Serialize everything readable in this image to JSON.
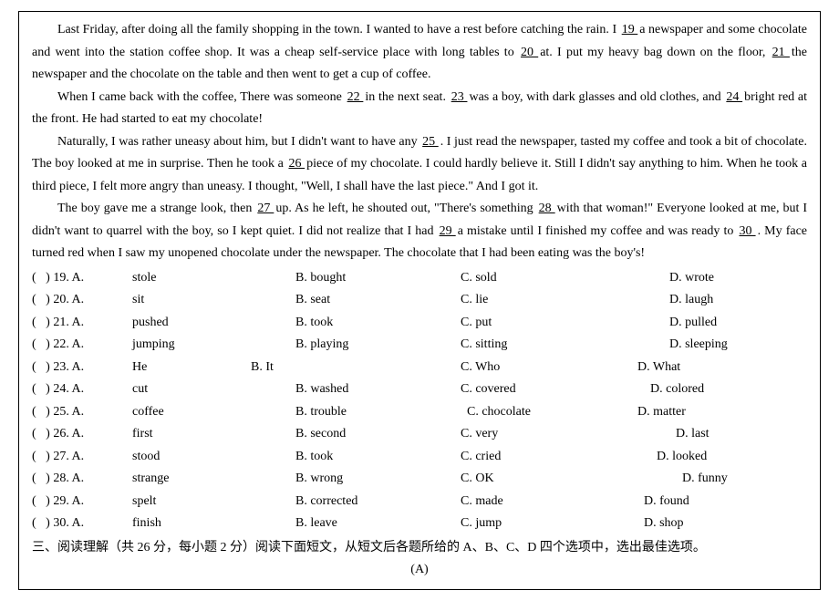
{
  "passage": {
    "p1_pre": "Last Friday, after doing all the family shopping in the town. I wanted to have a rest before catching the rain. I ",
    "b19": "  19  ",
    "p1_mid1": " a newspaper and some chocolate and went into the station coffee shop. It was a cheap self-service place with long tables to ",
    "b20": "  20  ",
    "p1_mid2": " at. I put my heavy bag down on the floor, ",
    "b21": "  21  ",
    "p1_end": " the newspaper and the chocolate on the table and then went to get a cup of coffee.",
    "p2_pre": "When I came back with the coffee, There was someone ",
    "b22": "  22  ",
    "p2_mid1": " in the next seat. ",
    "b23": "  23  ",
    "p2_mid2": " was a boy, with dark glasses and old clothes, and ",
    "b24": "  24  ",
    "p2_end": " bright red at the front. He had started to eat my chocolate!",
    "p3_pre": "Naturally, I was rather uneasy about him, but I didn't want to have any ",
    "b25": "  25  ",
    "p3_mid1": ". I just read the newspaper, tasted my coffee and took a bit of chocolate. The boy looked at me in surprise. Then he took a ",
    "b26": "  26  ",
    "p3_end": " piece of my chocolate. I could hardly believe it. Still I didn't say anything to him. When he took a third piece, I felt more angry than uneasy. I thought, \"Well, I shall have the last piece.\" And I got it.",
    "p4_pre": "The boy gave me a strange look, then ",
    "b27": "  27  ",
    "p4_mid1": " up. As he left, he shouted out, \"There's something ",
    "b28": "  28  ",
    "p4_mid2": " with that woman!\" Everyone looked at me, but I didn't want to quarrel with the boy, so I kept quiet. I did not realize that I had ",
    "b29": "  29  ",
    "p4_mid3": " a mistake until I finished my coffee and was ready to ",
    "b30": "  30  ",
    "p4_end": ". My face turned red when I saw my unopened chocolate under the newspaper. The chocolate that I had been eating was the boy's!"
  },
  "questions": [
    {
      "num": "(   ) 19. A. ",
      "a": "stole",
      "bpad": "              ",
      "b": "B. bought",
      "cpad": "",
      "c": "C. sold",
      "dpad": "              ",
      "d": "D. wrote"
    },
    {
      "num": "(   ) 20. A. ",
      "a": "sit",
      "bpad": "              ",
      "b": "B. seat",
      "cpad": "",
      "c": "C. lie",
      "dpad": "              ",
      "d": "D. laugh"
    },
    {
      "num": "(   ) 21. A. ",
      "a": "pushed",
      "bpad": "              ",
      "b": "B. took",
      "cpad": "",
      "c": "C. put",
      "dpad": "              ",
      "d": "D. pulled"
    },
    {
      "num": "(   ) 22. A. ",
      "a": "jumping",
      "bpad": "              ",
      "b": "B. playing",
      "cpad": "",
      "c": "C. sitting",
      "dpad": "              ",
      "d": "D. sleeping"
    },
    {
      "num": "(   ) 23. A. ",
      "a": "He",
      "bpad": "",
      "b": "B. It",
      "cpad": "",
      "c": "C. Who",
      "dpad": "    ",
      "d": "D. What"
    },
    {
      "num": "(   ) 24. A. ",
      "a": "cut",
      "bpad": "              ",
      "b": "B. washed",
      "cpad": "",
      "c": "C. covered",
      "dpad": "        ",
      "d": "D. colored"
    },
    {
      "num": "(   ) 25. A. ",
      "a": "coffee",
      "bpad": "              ",
      "b": "B. trouble",
      "cpad": "  ",
      "c": "C. chocolate",
      "dpad": "    ",
      "d": "D. matter"
    },
    {
      "num": "(   ) 26. A. ",
      "a": "first",
      "bpad": "              ",
      "b": "B. second",
      "cpad": "",
      "c": "C. very",
      "dpad": "                ",
      "d": "D. last"
    },
    {
      "num": "(   ) 27. A. ",
      "a": "stood",
      "bpad": "              ",
      "b": "B. took",
      "cpad": "",
      "c": "C. cried",
      "dpad": "          ",
      "d": "D. looked"
    },
    {
      "num": "(   ) 28. A. ",
      "a": "strange",
      "bpad": "              ",
      "b": "B. wrong",
      "cpad": "",
      "c": "C. OK",
      "dpad": "                  ",
      "d": "D. funny"
    },
    {
      "num": "(   ) 29. A. ",
      "a": "spelt",
      "bpad": "              ",
      "b": "B. corrected",
      "cpad": "",
      "c": "C. made",
      "dpad": "      ",
      "d": "D. found"
    },
    {
      "num": "(   ) 30. A. ",
      "a": "finish",
      "bpad": "              ",
      "b": "B. leave",
      "cpad": "",
      "c": "C. jump",
      "dpad": "      ",
      "d": "D. shop"
    }
  ],
  "section": {
    "heading": "三、阅读理解（共 26 分，每小题 2 分）阅读下面短文，从短文后各题所给的 A、B、C、D 四个选项中，选出最佳选项。",
    "sub": "(A)"
  }
}
